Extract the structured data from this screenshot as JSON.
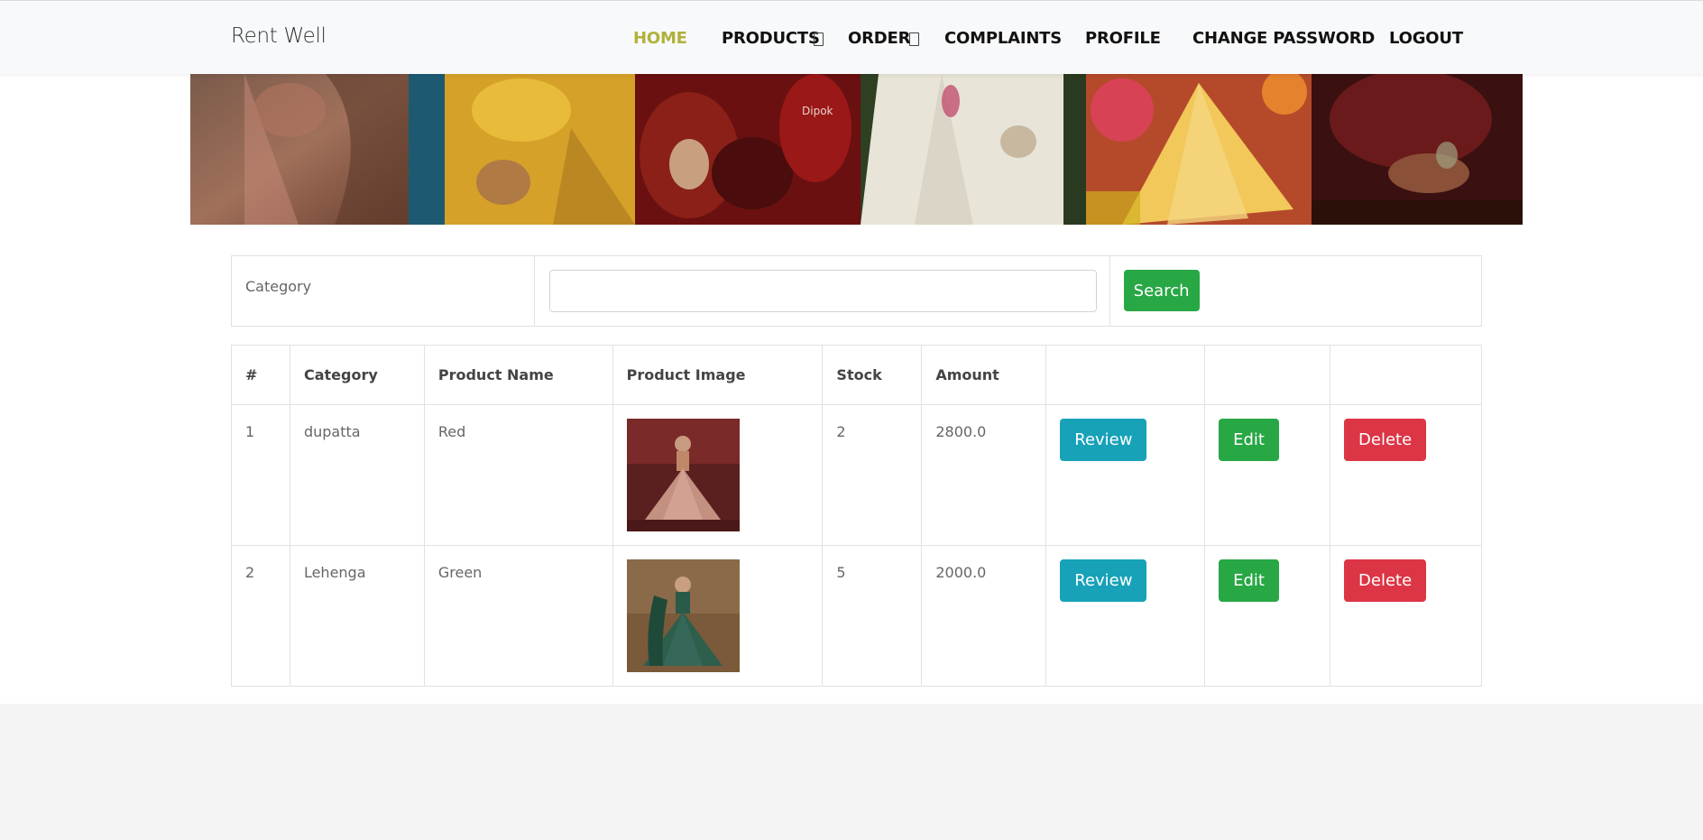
{
  "app": {
    "brand": "Rent Well"
  },
  "nav": {
    "items": [
      {
        "label": "HOME",
        "active": true
      },
      {
        "label": "PRODUCTS",
        "dropdown": true
      },
      {
        "label": "ORDER",
        "dropdown": true
      },
      {
        "label": "COMPLAINTS"
      },
      {
        "label": "PROFILE"
      },
      {
        "label": "CHANGE PASSWORD"
      },
      {
        "label": "LOGOUT"
      }
    ]
  },
  "banner": {
    "photos": [
      "saree-photo",
      "yellow-lehenga-photo",
      "bridal-hands-photo",
      "white-lehenga-photo",
      "yellow-dress-photo",
      "maroon-bridal-photo"
    ],
    "watermark": "Dipok"
  },
  "search": {
    "label": "Category",
    "input_value": "",
    "button_label": "Search"
  },
  "table": {
    "columns": [
      "#",
      "Category",
      "Product Name",
      "Product Image",
      "Stock",
      "Amount",
      "",
      "",
      ""
    ],
    "rows": [
      {
        "index": "1",
        "category": "dupatta",
        "product_name": "Red",
        "image": "red-lehenga-photo",
        "stock": "2",
        "amount": "2800.0",
        "review": "Review",
        "edit": "Edit",
        "delete": "Delete"
      },
      {
        "index": "2",
        "category": "Lehenga",
        "product_name": "Green",
        "image": "green-lehenga-photo",
        "stock": "5",
        "amount": "2000.0",
        "review": "Review",
        "edit": "Edit",
        "delete": "Delete"
      }
    ]
  },
  "colors": {
    "active_nav": "#b1b13a",
    "success": "#28a745",
    "info": "#17a2b8",
    "danger": "#dc3545"
  }
}
